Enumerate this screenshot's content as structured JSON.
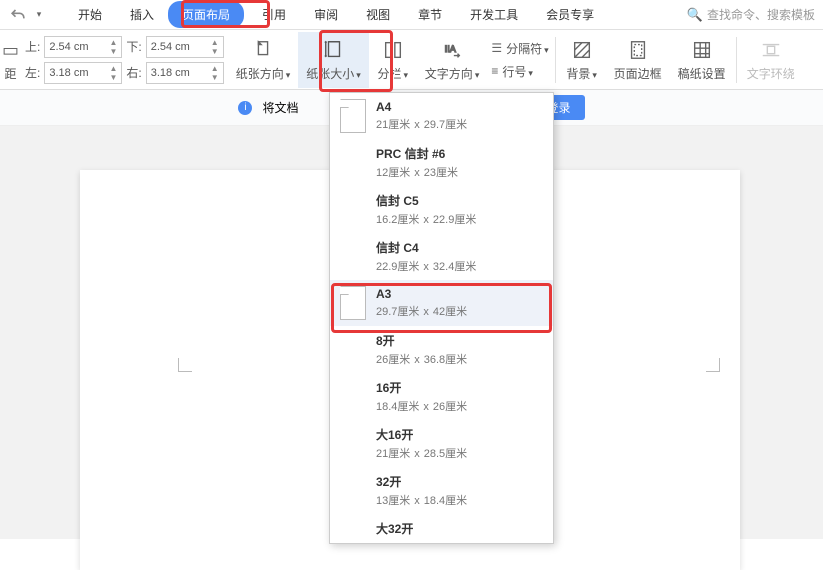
{
  "qat": {
    "undo_tip": "↶"
  },
  "tabs": {
    "start": "开始",
    "insert": "插入",
    "page_layout": "页面布局",
    "references": "引用",
    "review": "审阅",
    "view": "视图",
    "chapters": "章节",
    "dev_tools": "开发工具",
    "vip": "会员专享"
  },
  "search": {
    "placeholder": "查找命令、搜索模板"
  },
  "ribbon": {
    "margin_top_label": "上:",
    "margin_top_val": "2.54 cm",
    "margin_bottom_label": "下:",
    "margin_bottom_val": "2.54 cm",
    "margin_left_label": "左:",
    "margin_left_val": "3.18 cm",
    "margin_right_label": "右:",
    "margin_right_val": "3.18 cm",
    "margins_btn": "距",
    "orientation": "纸张方向",
    "paper_size": "纸张大小",
    "columns": "分栏",
    "text_direction": "文字方向",
    "separator": "分隔符",
    "line_number": "行号",
    "background": "背景",
    "page_border": "页面边框",
    "manuscript": "稿纸设置",
    "text_wrap": "文字环绕"
  },
  "info_bar": {
    "text_prefix": "将文档",
    "login_btn": "立即登录"
  },
  "paper_sizes": [
    {
      "name": "A4",
      "dims_l": "21厘米",
      "dims_r": "29.7厘米",
      "thumb": true
    },
    {
      "name": "PRC 信封 #6",
      "dims_l": "12厘米",
      "dims_r": "23厘米",
      "thumb": false
    },
    {
      "name": "信封 C5",
      "dims_l": "16.2厘米",
      "dims_r": "22.9厘米",
      "thumb": false
    },
    {
      "name": "信封 C4",
      "dims_l": "22.9厘米",
      "dims_r": "32.4厘米",
      "thumb": false
    },
    {
      "name": "A3",
      "dims_l": "29.7厘米",
      "dims_r": "42厘米",
      "thumb": true,
      "selected": true
    },
    {
      "name": "8开",
      "dims_l": "26厘米",
      "dims_r": "36.8厘米",
      "thumb": false
    },
    {
      "name": "16开",
      "dims_l": "18.4厘米",
      "dims_r": "26厘米",
      "thumb": false
    },
    {
      "name": "大16开",
      "dims_l": "21厘米",
      "dims_r": "28.5厘米",
      "thumb": false
    },
    {
      "name": "32开",
      "dims_l": "13厘米",
      "dims_r": "18.4厘米",
      "thumb": false
    },
    {
      "name": "大32开",
      "dims_l": "",
      "dims_r": "",
      "thumb": false
    }
  ],
  "dim_sep": "x"
}
